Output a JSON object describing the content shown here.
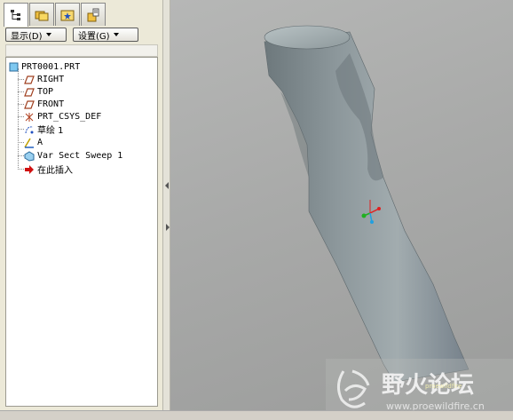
{
  "toolbar": {
    "tabs": [
      {
        "icon": "model-tree-icon"
      },
      {
        "icon": "folder-browser-icon"
      },
      {
        "icon": "favorites-icon"
      },
      {
        "icon": "connections-icon"
      }
    ],
    "show_button": "显示(D)",
    "settings_button": "设置(G)"
  },
  "model_tree": {
    "items": [
      {
        "label": "PRT0001.PRT",
        "icon": "part-icon"
      },
      {
        "label": "RIGHT",
        "icon": "datum-plane-icon"
      },
      {
        "label": "TOP",
        "icon": "datum-plane-icon"
      },
      {
        "label": "FRONT",
        "icon": "datum-plane-icon"
      },
      {
        "label": "PRT_CSYS_DEF",
        "icon": "coordinate-system-icon"
      },
      {
        "label": "草绘 1",
        "icon": "sketch-icon"
      },
      {
        "label": "A",
        "icon": "datum-axis-icon"
      },
      {
        "label": "Var Sect Sweep 1",
        "icon": "sweep-feature-icon"
      },
      {
        "label": "在此插入",
        "icon": "insert-here-arrow-icon"
      }
    ]
  },
  "watermark": {
    "title": "野火论坛",
    "url": "www.proewildfire.cn",
    "small_text": "proewildfire"
  },
  "colors": {
    "viewport_bg": "#a9aaa9",
    "model_surface": "#7f8a8e",
    "insert_arrow": "#d01010",
    "axis_red": "#e02020",
    "axis_green": "#20b020",
    "axis_blue": "#20a0e0"
  }
}
